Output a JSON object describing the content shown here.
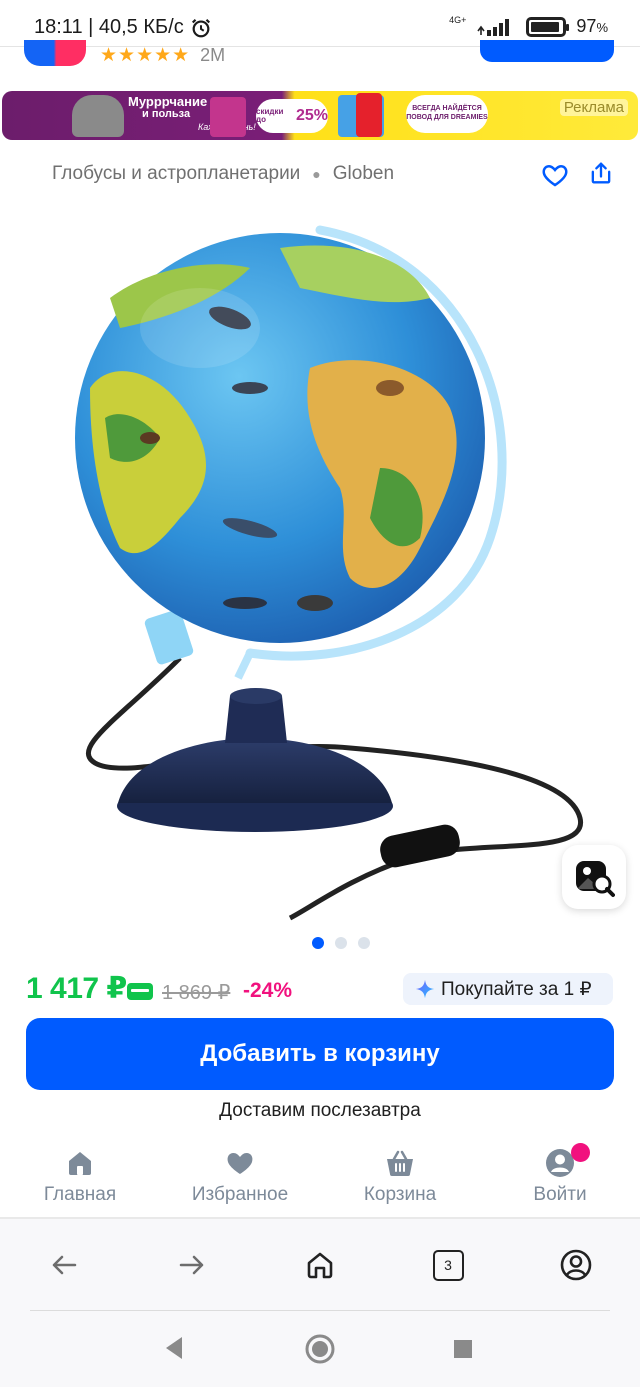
{
  "status_bar": {
    "time_speed": "18:11 | 40,5 КБ/с",
    "network": "4G+",
    "battery": "97"
  },
  "app_header": {
    "rating_count": "2M",
    "stars": "★★★★★"
  },
  "ad": {
    "headline": "Мурррчание",
    "subline": "и польза",
    "tagline": "Каждый день!",
    "badge_prefix": "скидки до",
    "badge_value": "25%",
    "cloud_text": "ВСЕГДА НАЙДЁТСЯ ПОВОД ДЛЯ DREAMIES",
    "label": "Реклама"
  },
  "breadcrumb": {
    "category": "Глобусы и астропланетарии",
    "brand": "Globen"
  },
  "carousel": {
    "total": 3,
    "active_index": 0
  },
  "price": {
    "current": "1 417 ₽",
    "old": "1 869 ₽",
    "discount": "-24%",
    "promo": "Покупайте за 1 ₽"
  },
  "cart": {
    "button_label": "Добавить в корзину",
    "delivery_prefix": "Доставим",
    "delivery_day": "послезавтра"
  },
  "app_nav": {
    "items": [
      {
        "label": "Главная",
        "icon": "home-icon"
      },
      {
        "label": "Избранное",
        "icon": "heart-icon"
      },
      {
        "label": "Корзина",
        "icon": "basket-icon"
      },
      {
        "label": "Войти",
        "icon": "user-icon"
      }
    ]
  },
  "browser": {
    "tabs_count": "3"
  },
  "colors": {
    "brand_blue": "#005bff",
    "price_green": "#10c44c",
    "discount_pink": "#f1117e"
  }
}
